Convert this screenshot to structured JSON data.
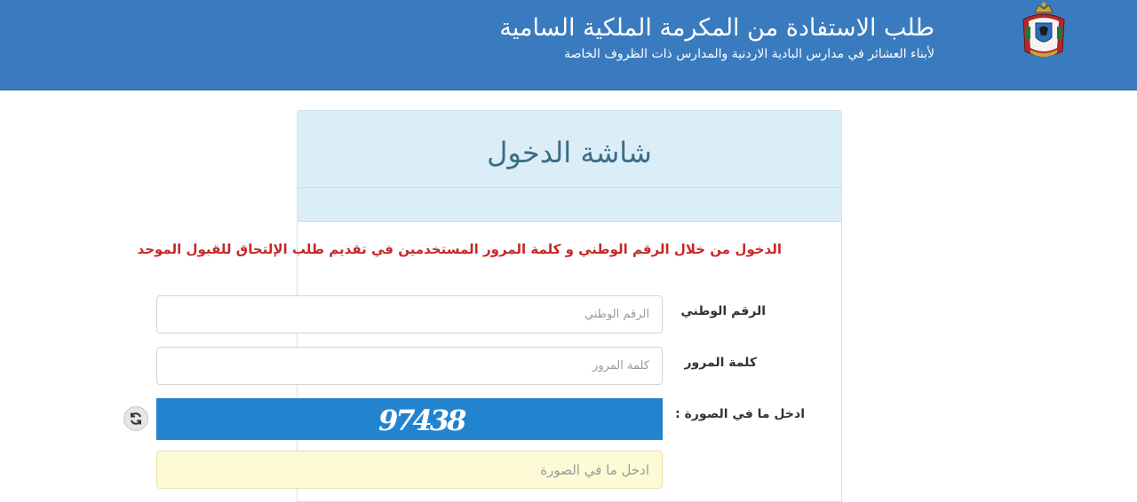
{
  "header": {
    "title": "طلب الاستفادة من المكرمة الملكية السامية",
    "subtitle": "لأبناء العشائر في مدارس البادية الاردنية والمدارس ذات الظروف الخاصة",
    "logo_icon": "royal-emblem-icon",
    "background_color": "#3a7bbf"
  },
  "panel": {
    "title": "شاشة الدخول"
  },
  "notice": "الدخول من خلال الرقم الوطني و كلمة المرور المستخدمين في تقديم طلب الإلتحاق للقبول الموحد",
  "form": {
    "national_id": {
      "label": "الرقم الوطني",
      "placeholder": "الرقم الوطني",
      "value": ""
    },
    "password": {
      "label": "كلمة المرور",
      "placeholder": "كلمة المرور",
      "value": ""
    },
    "captcha": {
      "label": "ادخل ما في الصورة :",
      "image_text": "97438",
      "placeholder": "ادخل ما في الصورة",
      "value": "",
      "refresh_icon": "refresh-icon"
    }
  },
  "colors": {
    "accent": "#3a7bbf",
    "notice": "#c62828",
    "captcha_bg": "#2283cf"
  }
}
